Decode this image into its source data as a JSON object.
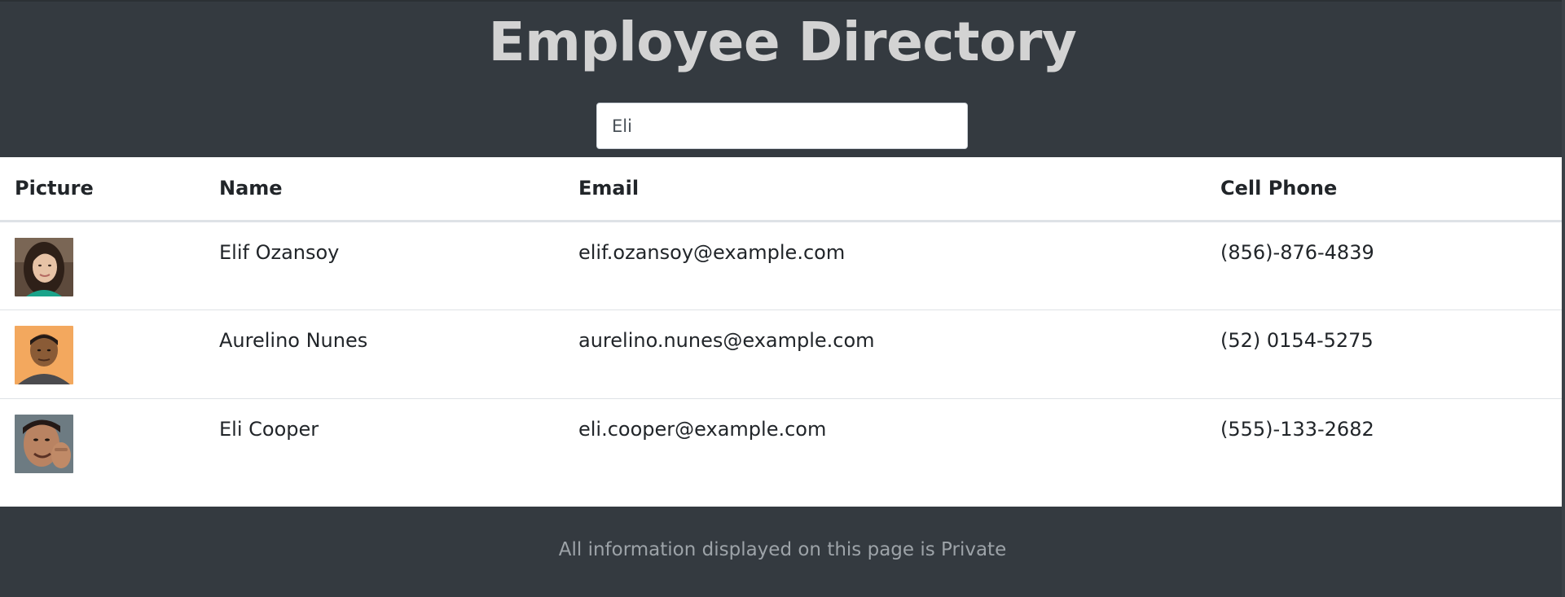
{
  "header": {
    "title": "Employee Directory",
    "search": {
      "value": "Eli",
      "placeholder": ""
    }
  },
  "table": {
    "columns": [
      "Picture",
      "Name",
      "Email",
      "Cell Phone"
    ],
    "rows": [
      {
        "picture": "avatar-woman-long-dark-hair",
        "name": "Elif Ozansoy",
        "email": "elif.ozansoy@example.com",
        "phone": "(856)-876-4839"
      },
      {
        "picture": "avatar-man-orange-background",
        "name": "Aurelino Nunes",
        "email": "aurelino.nunes@example.com",
        "phone": "(52) 0154-5275"
      },
      {
        "picture": "avatar-man-waving",
        "name": "Eli Cooper",
        "email": "eli.cooper@example.com",
        "phone": "(555)-133-2682"
      }
    ]
  },
  "footer": {
    "text": "All information displayed on this page is Private"
  },
  "colors": {
    "header_background": "#343a40",
    "title_color": "#d3d3d3",
    "table_background": "#ffffff",
    "footer_text": "#9da3a8"
  }
}
